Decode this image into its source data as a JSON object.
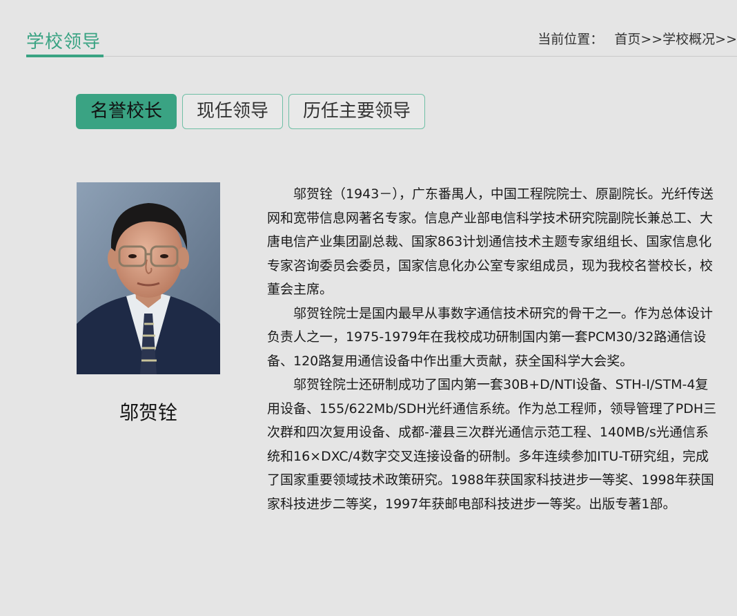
{
  "header": {
    "section_title": "学校领导",
    "breadcrumb_label": "当前位置：",
    "breadcrumb_path": "首页>>学校概况>>"
  },
  "tabs": [
    {
      "label": "名誉校长",
      "active": true
    },
    {
      "label": "现任领导",
      "active": false
    },
    {
      "label": "历任主要领导",
      "active": false
    }
  ],
  "profile": {
    "name": "邬贺铨",
    "paragraphs": [
      "邬贺铨（1943－），广东番禺人，中国工程院院士、原副院长。光纤传送网和宽带信息网著名专家。信息产业部电信科学技术研究院副院长兼总工、大唐电信产业集团副总裁、国家863计划通信技术主题专家组组长、国家信息化专家咨询委员会委员，国家信息化办公室专家组成员，现为我校名誉校长，校董会主席。",
      "邬贺铨院士是国内最早从事数字通信技术研究的骨干之一。作为总体设计负责人之一，1975-1979年在我校成功研制国内第一套PCM30/32路通信设备、120路复用通信设备中作出重大贡献，获全国科学大会奖。",
      "邬贺铨院士还研制成功了国内第一套30B+D/NTI设备、STH-I/STM-4复用设备、155/622Mb/SDH光纤通信系统。作为总工程师，领导管理了PDH三次群和四次复用设备、成都-灌县三次群光通信示范工程、140MB/s光通信系统和16×DXC/4数字交叉连接设备的研制。多年连续参加ITU-T研究组，完成了国家重要领域技术政策研究。1988年获国家科技进步一等奖、1998年获国家科技进步二等奖，1997年获邮电部科技进步一等奖。出版专著1部。"
    ]
  },
  "colors": {
    "accent": "#3aa383",
    "background": "#e5e5e5"
  }
}
